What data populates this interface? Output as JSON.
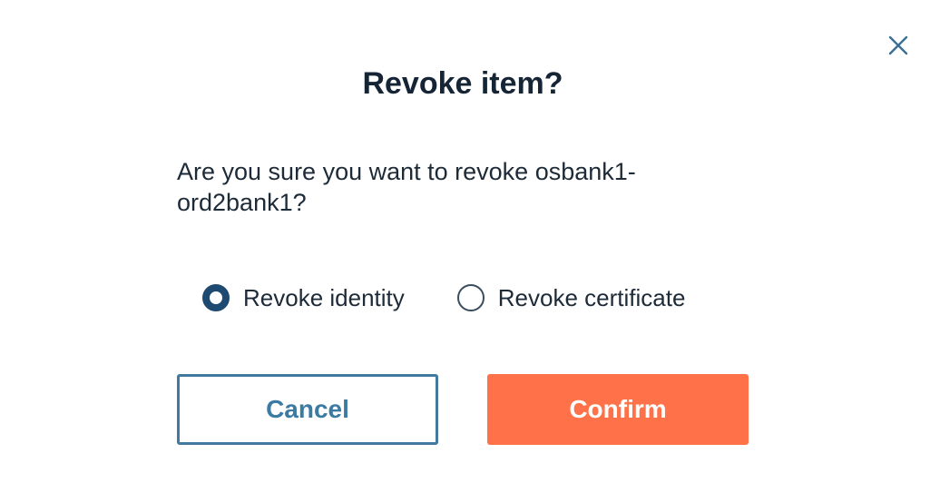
{
  "dialog": {
    "title": "Revoke item?",
    "message": "Are you sure you want to revoke osbank1-ord2bank1?",
    "close_icon": "close-icon",
    "options": [
      {
        "label": "Revoke identity",
        "selected": true
      },
      {
        "label": "Revoke certificate",
        "selected": false
      }
    ],
    "cancel_label": "Cancel",
    "confirm_label": "Confirm",
    "colors": {
      "title": "#152535",
      "radio_selected": "#1e4a72",
      "cancel_border": "#41799f",
      "cancel_text": "#3b7aa3",
      "confirm_background": "#ff7249",
      "confirm_text": "#ffffff",
      "close_icon": "#3b6f95"
    }
  }
}
